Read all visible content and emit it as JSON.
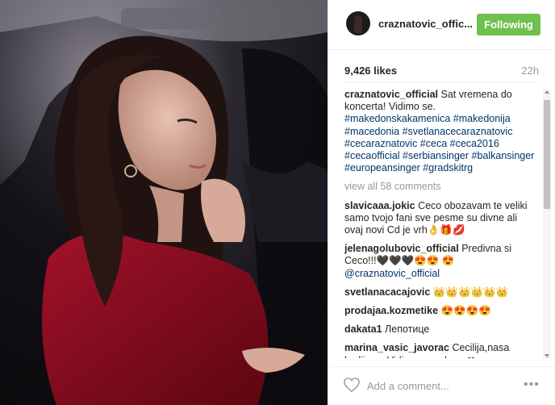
{
  "post": {
    "username": "craznatovic_offic...",
    "follow_label": "Following",
    "likes": "9,426 likes",
    "time_ago": "22h",
    "caption": {
      "username": "craznatovic_official",
      "text": "Sat vremena do koncerta! Vidimo se.",
      "hashtags": "#makedonskakamenica #makedonija #macedonia #svetlanacecaraznatovic #cecaraznatovic #ceca #ceca2016 #cecaofficial #serbiansinger #balkansinger #europeansinger #gradskitrg"
    },
    "view_all": "view all 58 comments",
    "add_comment_placeholder": "Add a comment...",
    "more_label": "•••"
  },
  "comments": [
    {
      "user": "slavicaaa.jokic",
      "text": "Ceco obozavam te veliki samo tvojo fani sve pesme su divne ali ovaj novi Cd je vrh👌🎁💋"
    },
    {
      "user": "jelenagolubovic_official",
      "text": "Predivna si Ceco!!!🖤🖤🖤😍😍",
      "mention": "😍@craznatovic_official"
    },
    {
      "user": "svetlanacacajovic",
      "text": "👑👑👑👑👑👑"
    },
    {
      "user": "prodajaa.kozmetike",
      "text": "😍😍😍😍"
    },
    {
      "user": "dakata1",
      "text": "Лепотице"
    },
    {
      "user": "marina_vasic_javorac",
      "text": "Cecilija,nasa kraljice... Vidimo se uskoro ❤"
    }
  ],
  "colors": {
    "follow_button": "#70c050",
    "hashtag": "#003569",
    "muted": "#999999"
  },
  "icons": [
    "heart-icon",
    "more-options-icon",
    "scroll-up-arrow-icon",
    "scroll-down-arrow-icon"
  ]
}
